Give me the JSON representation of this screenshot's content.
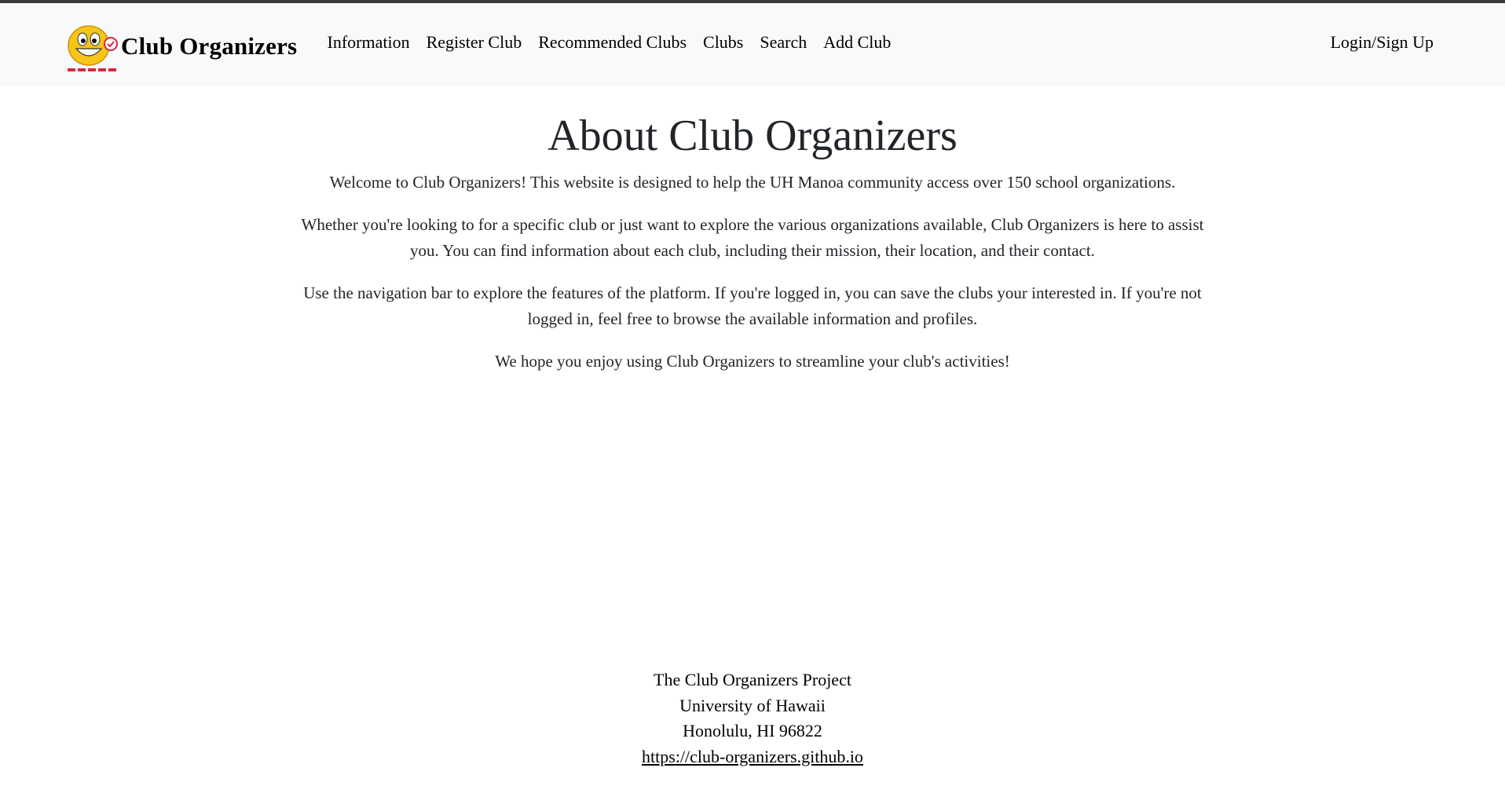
{
  "brand": {
    "title": "Club Organizers",
    "logo_icon": "smiley-face-logo-icon"
  },
  "nav": {
    "items": [
      {
        "label": "Information"
      },
      {
        "label": "Register Club"
      },
      {
        "label": "Recommended Clubs"
      },
      {
        "label": "Clubs"
      },
      {
        "label": "Search"
      },
      {
        "label": "Add Club"
      }
    ],
    "login_label": "Login/Sign Up"
  },
  "main": {
    "title": "About Club Organizers",
    "paragraphs": [
      "Welcome to Club Organizers! This website is designed to help the UH Manoa community access over 150 school organizations.",
      "Whether you're looking to for a specific club or just want to explore the various organizations available, Club Organizers is here to assist you. You can find information about each club, including their mission, their location, and their contact.",
      "Use the navigation bar to explore the features of the platform. If you're logged in, you can save the clubs your interested in. If you're not logged in, feel free to browse the available information and profiles.",
      "We hope you enjoy using Club Organizers to streamline your club's activities!"
    ]
  },
  "footer": {
    "line1": "The Club Organizers Project",
    "line2": "University of Hawaii",
    "line3": "Honolulu, HI 96822",
    "link": "https://club-organizers.github.io"
  },
  "colors": {
    "navbar_bg": "#f8f9fa",
    "text": "#212529",
    "logo_yellow": "#f5c518",
    "logo_red": "#d7263d"
  }
}
